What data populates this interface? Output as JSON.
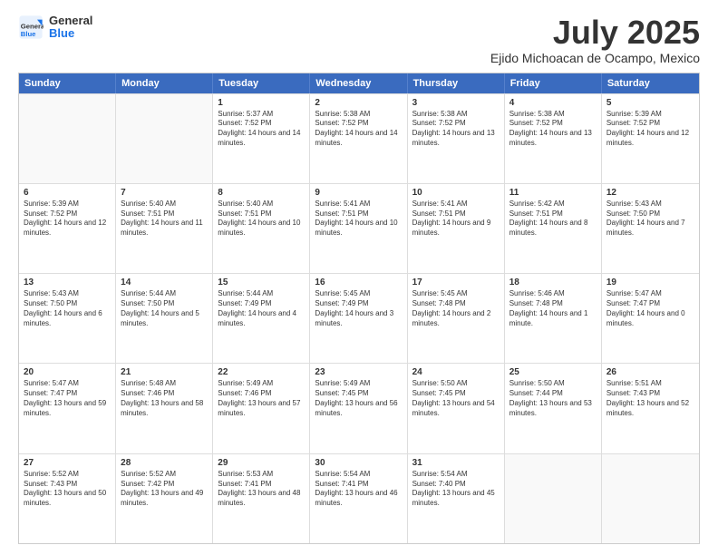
{
  "header": {
    "logo_line1": "General",
    "logo_line2": "Blue",
    "title": "July 2025",
    "subtitle": "Ejido Michoacan de Ocampo, Mexico"
  },
  "calendar": {
    "days_of_week": [
      "Sunday",
      "Monday",
      "Tuesday",
      "Wednesday",
      "Thursday",
      "Friday",
      "Saturday"
    ],
    "weeks": [
      [
        {
          "day": "",
          "empty": true
        },
        {
          "day": "",
          "empty": true
        },
        {
          "day": "1",
          "sunrise": "5:37 AM",
          "sunset": "7:52 PM",
          "daylight": "14 hours and 14 minutes."
        },
        {
          "day": "2",
          "sunrise": "5:38 AM",
          "sunset": "7:52 PM",
          "daylight": "14 hours and 14 minutes."
        },
        {
          "day": "3",
          "sunrise": "5:38 AM",
          "sunset": "7:52 PM",
          "daylight": "14 hours and 13 minutes."
        },
        {
          "day": "4",
          "sunrise": "5:38 AM",
          "sunset": "7:52 PM",
          "daylight": "14 hours and 13 minutes."
        },
        {
          "day": "5",
          "sunrise": "5:39 AM",
          "sunset": "7:52 PM",
          "daylight": "14 hours and 12 minutes."
        }
      ],
      [
        {
          "day": "6",
          "sunrise": "5:39 AM",
          "sunset": "7:52 PM",
          "daylight": "14 hours and 12 minutes."
        },
        {
          "day": "7",
          "sunrise": "5:40 AM",
          "sunset": "7:51 PM",
          "daylight": "14 hours and 11 minutes."
        },
        {
          "day": "8",
          "sunrise": "5:40 AM",
          "sunset": "7:51 PM",
          "daylight": "14 hours and 10 minutes."
        },
        {
          "day": "9",
          "sunrise": "5:41 AM",
          "sunset": "7:51 PM",
          "daylight": "14 hours and 10 minutes."
        },
        {
          "day": "10",
          "sunrise": "5:41 AM",
          "sunset": "7:51 PM",
          "daylight": "14 hours and 9 minutes."
        },
        {
          "day": "11",
          "sunrise": "5:42 AM",
          "sunset": "7:51 PM",
          "daylight": "14 hours and 8 minutes."
        },
        {
          "day": "12",
          "sunrise": "5:43 AM",
          "sunset": "7:50 PM",
          "daylight": "14 hours and 7 minutes."
        }
      ],
      [
        {
          "day": "13",
          "sunrise": "5:43 AM",
          "sunset": "7:50 PM",
          "daylight": "14 hours and 6 minutes."
        },
        {
          "day": "14",
          "sunrise": "5:44 AM",
          "sunset": "7:50 PM",
          "daylight": "14 hours and 5 minutes."
        },
        {
          "day": "15",
          "sunrise": "5:44 AM",
          "sunset": "7:49 PM",
          "daylight": "14 hours and 4 minutes."
        },
        {
          "day": "16",
          "sunrise": "5:45 AM",
          "sunset": "7:49 PM",
          "daylight": "14 hours and 3 minutes."
        },
        {
          "day": "17",
          "sunrise": "5:45 AM",
          "sunset": "7:48 PM",
          "daylight": "14 hours and 2 minutes."
        },
        {
          "day": "18",
          "sunrise": "5:46 AM",
          "sunset": "7:48 PM",
          "daylight": "14 hours and 1 minute."
        },
        {
          "day": "19",
          "sunrise": "5:47 AM",
          "sunset": "7:47 PM",
          "daylight": "14 hours and 0 minutes."
        }
      ],
      [
        {
          "day": "20",
          "sunrise": "5:47 AM",
          "sunset": "7:47 PM",
          "daylight": "13 hours and 59 minutes."
        },
        {
          "day": "21",
          "sunrise": "5:48 AM",
          "sunset": "7:46 PM",
          "daylight": "13 hours and 58 minutes."
        },
        {
          "day": "22",
          "sunrise": "5:49 AM",
          "sunset": "7:46 PM",
          "daylight": "13 hours and 57 minutes."
        },
        {
          "day": "23",
          "sunrise": "5:49 AM",
          "sunset": "7:45 PM",
          "daylight": "13 hours and 56 minutes."
        },
        {
          "day": "24",
          "sunrise": "5:50 AM",
          "sunset": "7:45 PM",
          "daylight": "13 hours and 54 minutes."
        },
        {
          "day": "25",
          "sunrise": "5:50 AM",
          "sunset": "7:44 PM",
          "daylight": "13 hours and 53 minutes."
        },
        {
          "day": "26",
          "sunrise": "5:51 AM",
          "sunset": "7:43 PM",
          "daylight": "13 hours and 52 minutes."
        }
      ],
      [
        {
          "day": "27",
          "sunrise": "5:52 AM",
          "sunset": "7:43 PM",
          "daylight": "13 hours and 50 minutes."
        },
        {
          "day": "28",
          "sunrise": "5:52 AM",
          "sunset": "7:42 PM",
          "daylight": "13 hours and 49 minutes."
        },
        {
          "day": "29",
          "sunrise": "5:53 AM",
          "sunset": "7:41 PM",
          "daylight": "13 hours and 48 minutes."
        },
        {
          "day": "30",
          "sunrise": "5:54 AM",
          "sunset": "7:41 PM",
          "daylight": "13 hours and 46 minutes."
        },
        {
          "day": "31",
          "sunrise": "5:54 AM",
          "sunset": "7:40 PM",
          "daylight": "13 hours and 45 minutes."
        },
        {
          "day": "",
          "empty": true
        },
        {
          "day": "",
          "empty": true
        }
      ]
    ]
  }
}
